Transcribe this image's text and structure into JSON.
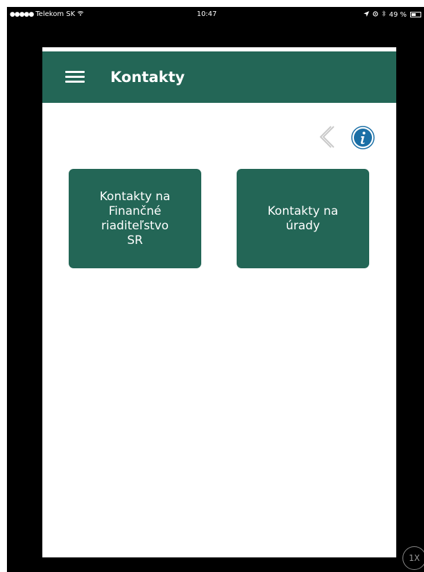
{
  "status_bar": {
    "carrier": "Telekom SK",
    "time": "10:47",
    "battery": "49 %",
    "battery_level": 0.49
  },
  "header": {
    "title": "Kontakty",
    "menu_icon": "hamburger-menu-icon"
  },
  "toolbar": {
    "back_icon": "chevron-left-icon",
    "info_icon": "info-icon"
  },
  "tiles": [
    {
      "label": "Kontakty na\nFinančné\nriaditeľstvo\nSR"
    },
    {
      "label": "Kontakty na\núrady"
    }
  ],
  "zoom_badge": "1X",
  "colors": {
    "primary": "#236656",
    "info": "#1a6fa6",
    "frame": "#000000"
  }
}
